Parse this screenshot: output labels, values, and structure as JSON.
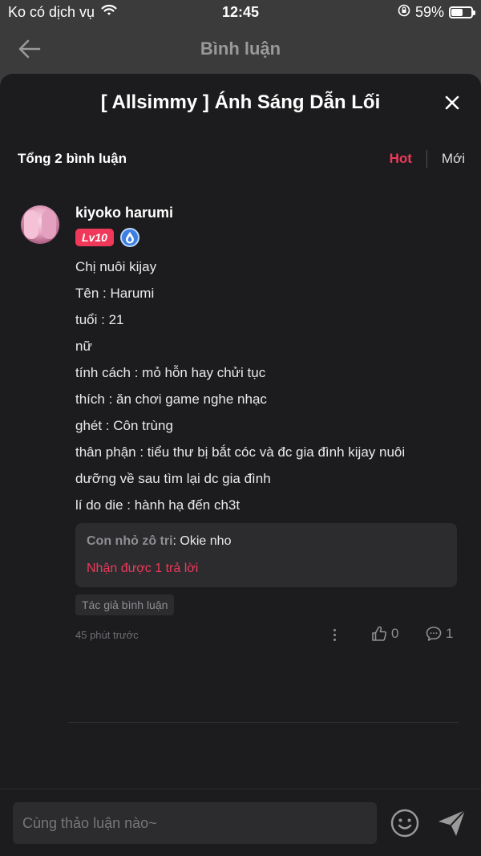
{
  "status_bar": {
    "carrier": "Ko có dịch vụ",
    "time": "12:45",
    "battery": "59%",
    "battery_level": 0.59
  },
  "navbar": {
    "title": "Bình luận"
  },
  "sheet": {
    "title": "[ Allsimmy ] Ánh Sáng Dẫn Lối",
    "count_label": "Tổng 2 bình luận",
    "sort_hot": "Hot",
    "sort_new": "Mới"
  },
  "comment": {
    "username": "kiyoko harumi",
    "level": "Lv10",
    "lines": [
      "Chị nuôi kijay",
      "Tên : Harumi",
      "tuổi : 21",
      "nữ",
      "tính cách : mỏ hỗn hay chửi tục",
      "thích : ăn chơi game nghe nhạc",
      "ghét : Côn trùng",
      "thân phận : tiểu thư bị bắt cóc và đc gia đình kijay nuôi",
      "dưỡng về sau tìm lại dc gia đình",
      "lí do die : hành hạ đến ch3t"
    ],
    "reply_name": "Con nhỏ zô tri",
    "reply_text": ": Okie nho",
    "reply_count": "Nhận được 1 trả lời",
    "author_tag": "Tác giả bình luận",
    "time": "45 phút trước",
    "likes": "0",
    "replies": "1"
  },
  "input": {
    "placeholder": "Cùng thảo luận nào~"
  },
  "colors": {
    "accent": "#f0385b",
    "sheet_bg": "#1c1c1e"
  }
}
